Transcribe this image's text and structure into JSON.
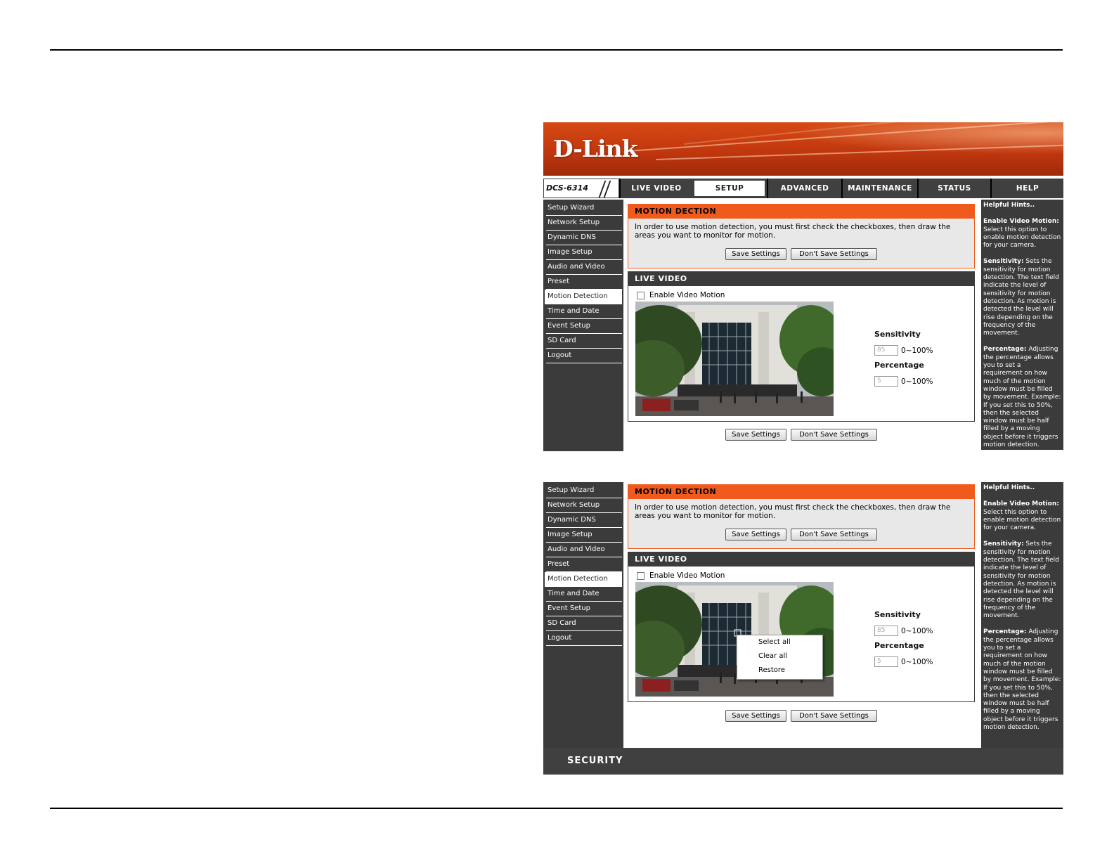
{
  "brand": {
    "logo": "D-Link",
    "model": "DCS-6314",
    "footer": "SECURITY"
  },
  "nav": {
    "tabs": [
      "LIVE VIDEO",
      "SETUP",
      "ADVANCED",
      "MAINTENANCE",
      "STATUS",
      "HELP"
    ],
    "active": "SETUP"
  },
  "sidebar": {
    "items": [
      "Setup Wizard",
      "Network Setup",
      "Dynamic DNS",
      "Image Setup",
      "Audio and Video",
      "Preset",
      "Motion Detection",
      "Time and Date",
      "Event Setup",
      "SD Card",
      "Logout"
    ],
    "active": "Motion Detection"
  },
  "motion": {
    "title": "MOTION DECTION",
    "description": "In order to use motion detection, you must first check the checkboxes, then draw the areas you want to monitor for motion.",
    "save_label": "Save Settings",
    "dont_save_label": "Don't Save Settings"
  },
  "live": {
    "title": "LIVE VIDEO",
    "enable_label": "Enable Video Motion",
    "enable_checked": false,
    "sensitivity_label": "Sensitivity",
    "sensitivity_value": "85",
    "sensitivity_unit": "0~100%",
    "percentage_label": "Percentage",
    "percentage_value": "5",
    "percentage_unit": "0~100%"
  },
  "context_menu": {
    "items": [
      "Select all",
      "Clear all",
      "Restore"
    ]
  },
  "hints": {
    "title": "Helpful Hints..",
    "enable_title": "Enable Video Motion:",
    "enable_text": "Select this option to enable motion detection for your camera.",
    "sens_title": "Sensitivity:",
    "sens_text": "Sets the sensitivity for motion detection. The text field indicate the level of sensitivity for motion detection. As motion is detected the level will rise depending on the frequency of the movement.",
    "pct_title": "Percentage:",
    "pct_text": "Adjusting the percentage allows you to set a requirement on how much of the motion window must be filled by movement. Example: If you set this to 50%, then the selected window must be half filled by a moving object before it triggers motion detection."
  },
  "colors": {
    "accent": "#f05a1c",
    "dark": "#3b3b3b",
    "banner": "#c1370e"
  }
}
